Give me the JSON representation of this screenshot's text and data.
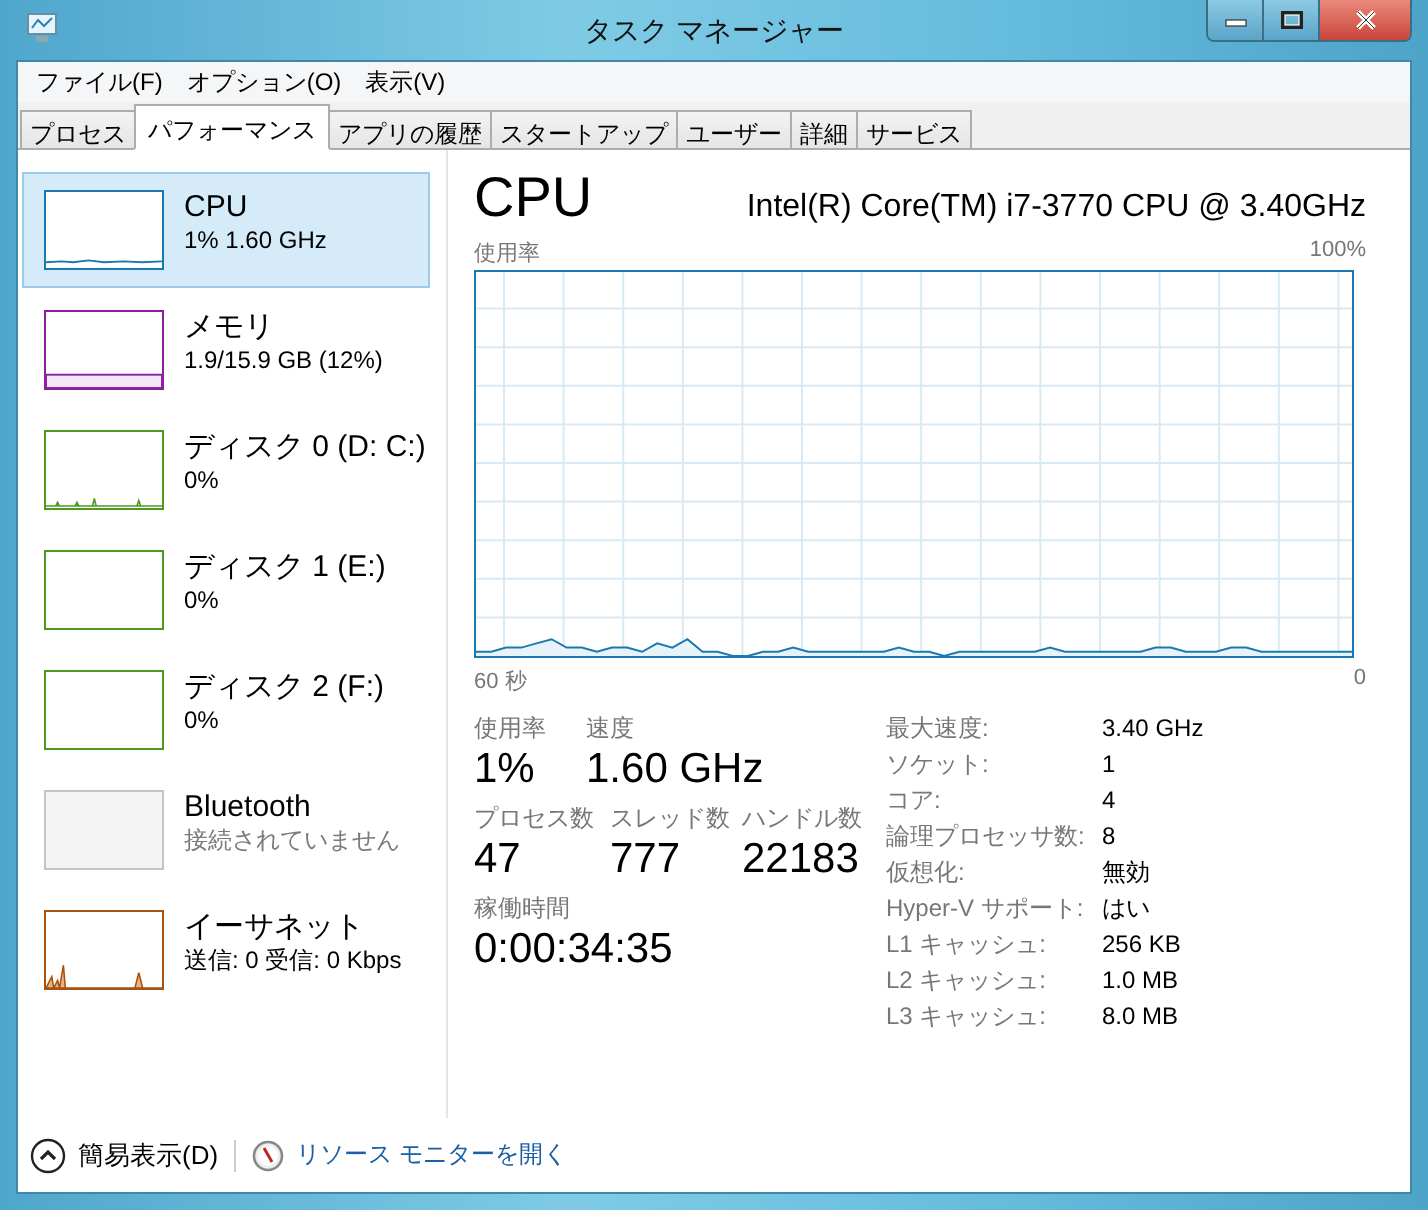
{
  "window": {
    "title": "タスク マネージャー"
  },
  "menu": [
    "ファイル(F)",
    "オプション(O)",
    "表示(V)"
  ],
  "tabs": [
    {
      "label": "プロセス",
      "selected": false
    },
    {
      "label": "パフォーマンス",
      "selected": true
    },
    {
      "label": "アプリの履歴",
      "selected": false
    },
    {
      "label": "スタートアップ",
      "selected": false
    },
    {
      "label": "ユーザー",
      "selected": false
    },
    {
      "label": "詳細",
      "selected": false
    },
    {
      "label": "サービス",
      "selected": false
    }
  ],
  "sidebar": {
    "items": [
      {
        "kind": "cpu",
        "name": "CPU",
        "detail": "1% 1.60 GHz",
        "color": "#1b79b2",
        "selected": true,
        "disabled": false
      },
      {
        "kind": "memory",
        "name": "メモリ",
        "detail": "1.9/15.9 GB (12%)",
        "color": "#8b1f9e",
        "selected": false,
        "disabled": false
      },
      {
        "kind": "disk",
        "name": "ディスク 0 (D: C:)",
        "detail": "0%",
        "color": "#4d9a1e",
        "selected": false,
        "disabled": false
      },
      {
        "kind": "idle",
        "name": "ディスク 1 (E:)",
        "detail": "0%",
        "color": "#4d9a1e",
        "selected": false,
        "disabled": false
      },
      {
        "kind": "idle",
        "name": "ディスク 2 (F:)",
        "detail": "0%",
        "color": "#4d9a1e",
        "selected": false,
        "disabled": false
      },
      {
        "kind": "none",
        "name": "Bluetooth",
        "detail": "接続されていません",
        "color": "#c4c4c4",
        "selected": false,
        "disabled": true
      },
      {
        "kind": "network",
        "name": "イーサネット",
        "detail": "送信: 0 受信: 0 Kbps",
        "color": "#a7520f",
        "selected": false,
        "disabled": false
      }
    ]
  },
  "detail": {
    "title": "CPU",
    "model": "Intel(R) Core(TM) i7-3770 CPU @ 3.40GHz",
    "graph": {
      "label": "使用率",
      "max_label": "100%",
      "time_label": "60 秒",
      "end_label": "0"
    },
    "stat_rows": [
      [
        {
          "label": "使用率",
          "value": "1%"
        },
        {
          "label": "速度",
          "value": "1.60 GHz"
        }
      ],
      [
        {
          "label": "プロセス数",
          "value": "47"
        },
        {
          "label": "スレッド数",
          "value": "777"
        },
        {
          "label": "ハンドル数",
          "value": "22183"
        }
      ],
      [
        {
          "label": "稼働時間",
          "value": "0:00:34:35"
        }
      ]
    ],
    "specs": [
      {
        "label": "最大速度:",
        "value": "3.40 GHz"
      },
      {
        "label": "ソケット:",
        "value": "1"
      },
      {
        "label": "コア:",
        "value": "4"
      },
      {
        "label": "論理プロセッサ数:",
        "value": "8"
      },
      {
        "label": "仮想化:",
        "value": "無効"
      },
      {
        "label": "Hyper-V サポート:",
        "value": "はい"
      },
      {
        "label": "L1 キャッシュ:",
        "value": "256 KB"
      },
      {
        "label": "L2 キャッシュ:",
        "value": "1.0 MB"
      },
      {
        "label": "L3 キャッシュ:",
        "value": "8.0 MB"
      }
    ]
  },
  "footer": {
    "fewer_details": "簡易表示(D)",
    "resource_monitor": "リソース モニターを開く"
  }
}
